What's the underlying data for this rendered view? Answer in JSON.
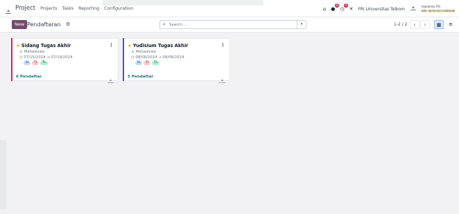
{
  "topbar": {
    "brand": "Project",
    "menu": [
      "Projects",
      "Tasks",
      "Reporting",
      "Configuration"
    ],
    "badges": {
      "chat": "8",
      "activity": "9"
    },
    "company": "FRI Universitas Telkom",
    "user_name": "Akademik FRI",
    "user_email": "edu-naresvarisdoocom"
  },
  "control": {
    "new_label": "New",
    "breadcrumb": "Pendaftaran",
    "search_placeholder": "Search...",
    "pager": "1-2 / 2"
  },
  "cards": [
    {
      "title": "Sidang Tugas Akhir",
      "group": "Mahasiswa",
      "dates": "07/15/2024 → 07/19/2024",
      "tags": [
        "SI",
        "TI",
        "TL"
      ],
      "count": "6 Pendaftar",
      "accent": "#e11d48"
    },
    {
      "title": "Yudisium Tugas Akhir",
      "group": "Mahasiswa",
      "dates": "08/08/2024 → 08/08/2024",
      "tags": [
        "SI",
        "TI",
        "TL"
      ],
      "count": "5 Pendaftar",
      "accent": "#4f46e5"
    }
  ],
  "tag_colors": {
    "SI": "#bfdbfe",
    "TI": "#fecaca",
    "TL": "#a7f3d0"
  }
}
